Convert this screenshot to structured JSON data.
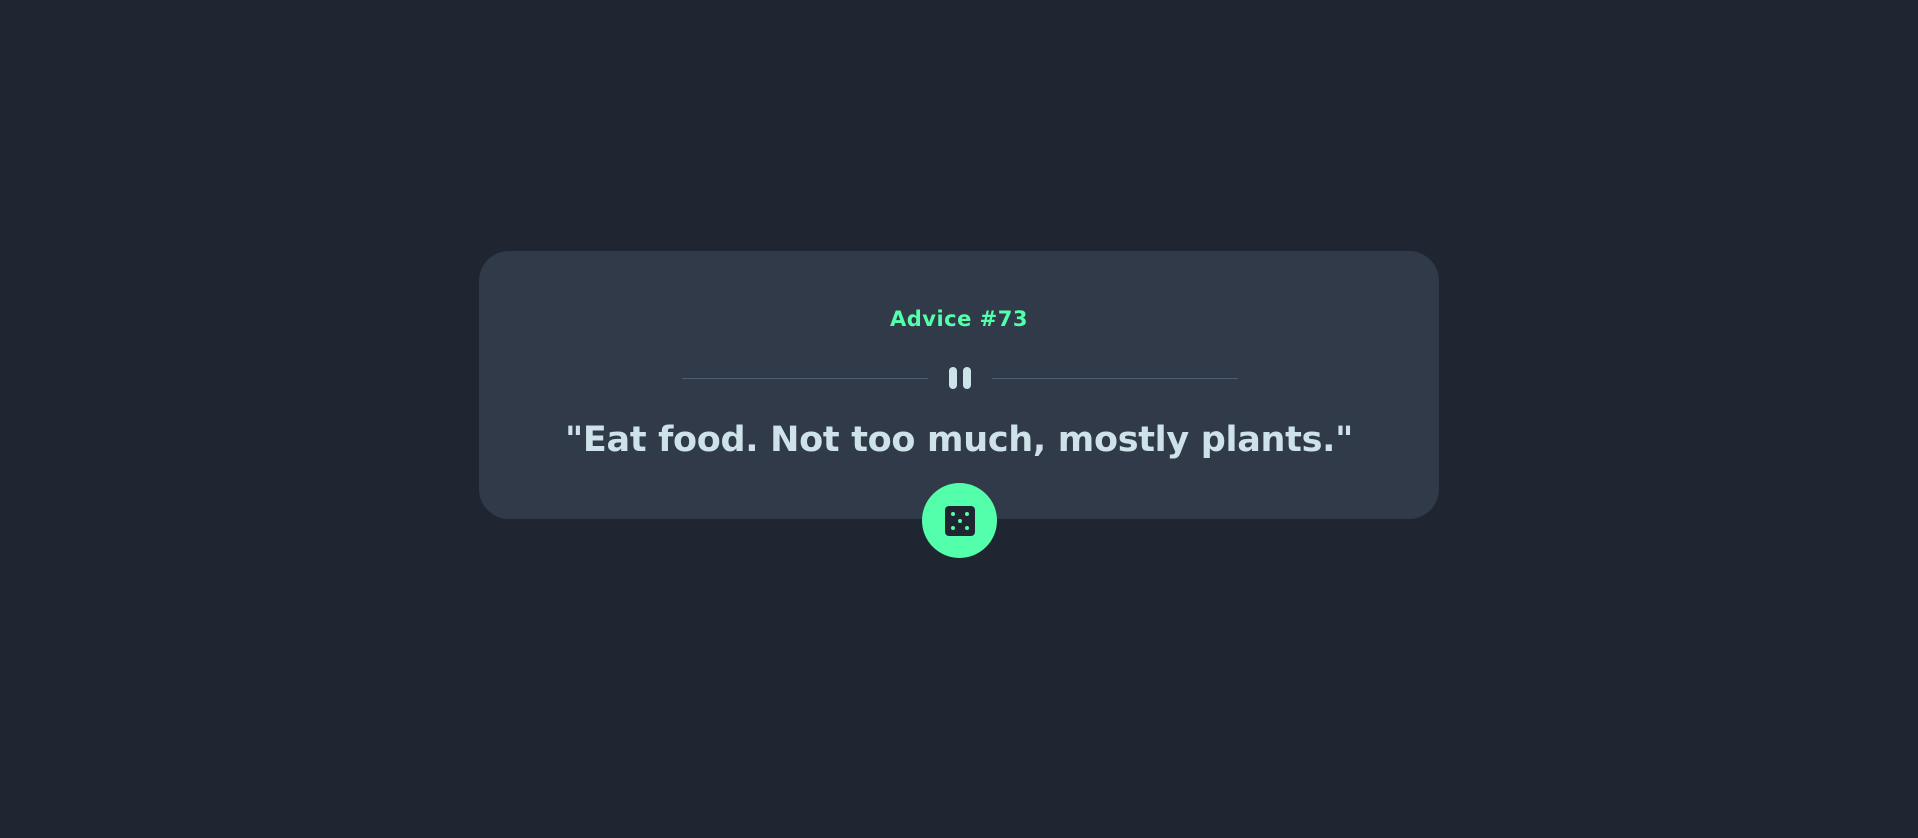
{
  "advice": {
    "label": "Advice #73",
    "quote": "\"Eat food. Not too much, mostly plants.\""
  },
  "icons": {
    "divider": "pause-quote-icon",
    "button": "dice-icon"
  },
  "colors": {
    "background": "#1f2632",
    "card": "#313a49",
    "accent": "#53ffaa",
    "text": "#cee3e9",
    "divider": "#4f5d74"
  }
}
